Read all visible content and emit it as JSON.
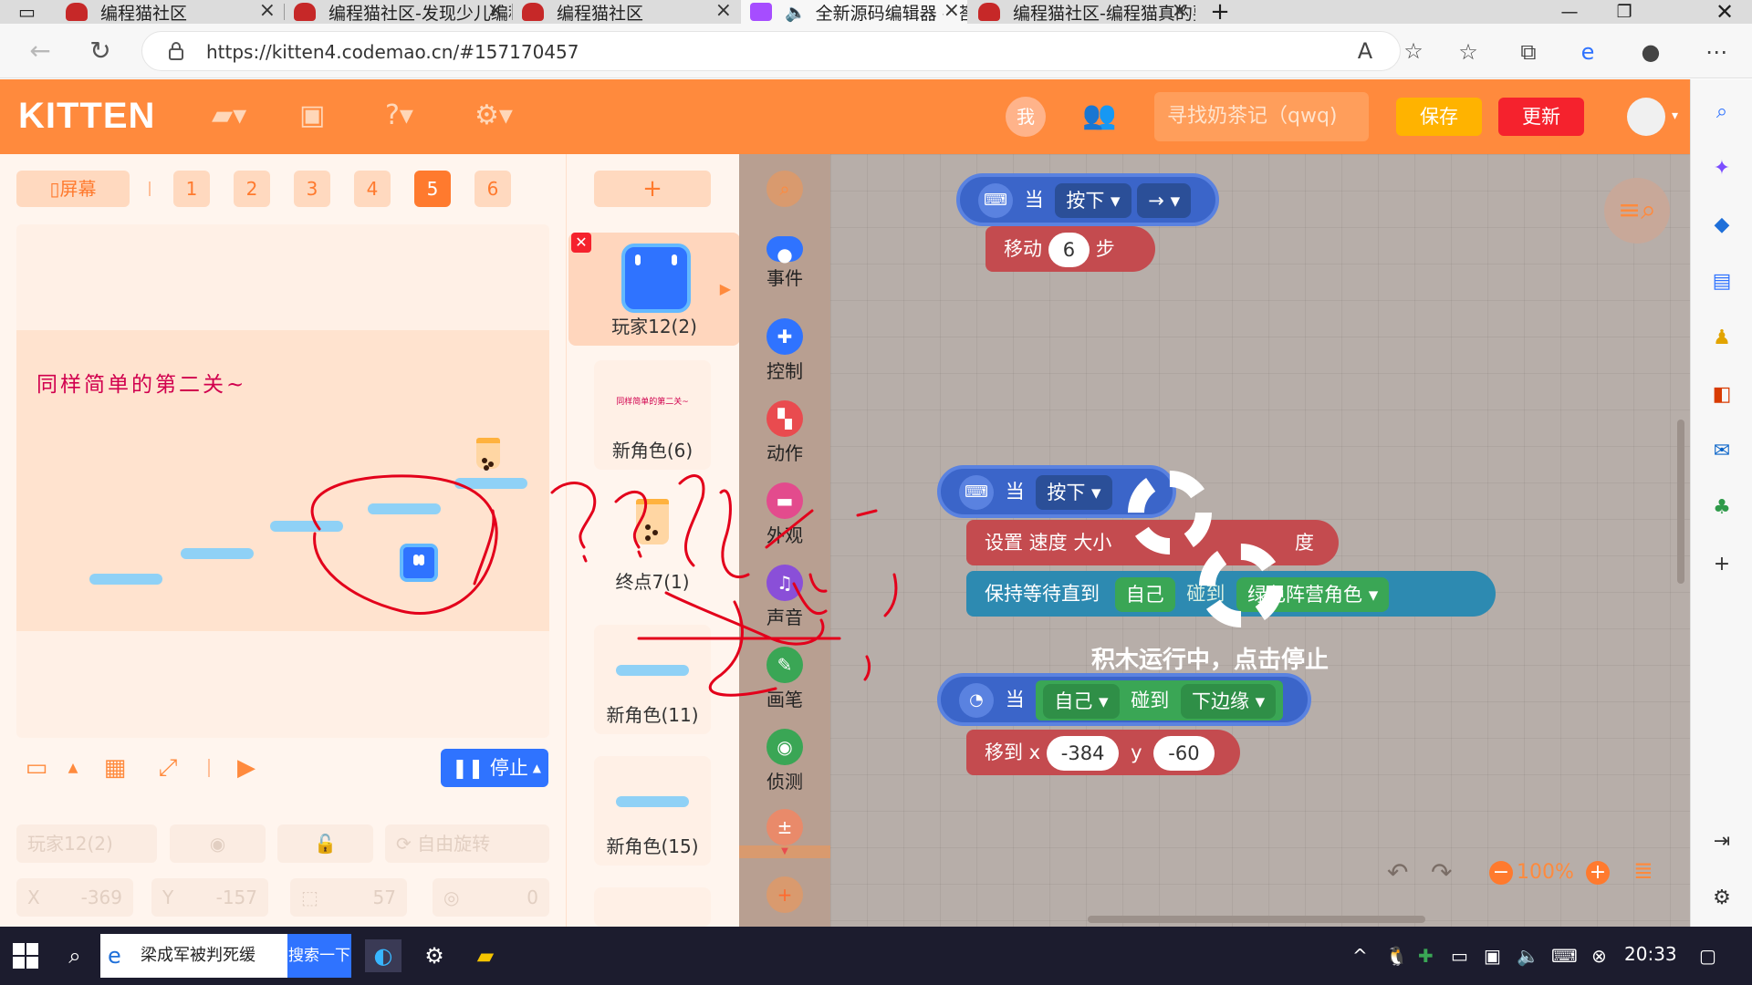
{
  "browser": {
    "tabs": [
      {
        "title": "编程猫社区"
      },
      {
        "title": "编程猫社区-发现少儿编程"
      },
      {
        "title": "编程猫社区"
      },
      {
        "title": "全新源码编辑器 - 搭建"
      },
      {
        "title": "编程猫社区-编程猫真的要"
      }
    ],
    "url": "https://kitten4.codemao.cn/#157170457"
  },
  "header": {
    "logo": "KITTEN",
    "me_label": "我",
    "project_name": "寻找奶茶记（qwq)",
    "save_label": "保存",
    "update_label": "更新"
  },
  "stage_panel": {
    "screen_label": "屏幕",
    "scenes": [
      "1",
      "2",
      "3",
      "4",
      "5",
      "6"
    ],
    "active_scene": "5",
    "stage_text": "同样简单的第二关~",
    "stop_label": "停止",
    "properties": {
      "sprite_name_placeholder": "玩家12(2)",
      "rotate_label": "自由旋转",
      "x_label": "X",
      "x_value": "-369",
      "y_label": "Y",
      "y_value": "-157",
      "size_value": "57",
      "direction_value": "0"
    }
  },
  "sprites": {
    "add_label": "+",
    "items": [
      {
        "name": "玩家12(2)",
        "active": true
      },
      {
        "name": "新角色(6)",
        "thumb_text": "同样简单的第二关~"
      },
      {
        "name": "终点7(1)"
      },
      {
        "name": "新角色(11)"
      },
      {
        "name": "新角色(15)"
      }
    ]
  },
  "categories": [
    {
      "label": "事件",
      "color": "#2f73ff"
    },
    {
      "label": "控制",
      "color": "#2f73ff"
    },
    {
      "label": "动作",
      "color": "#e94b4f"
    },
    {
      "label": "外观",
      "color": "#e34b8d"
    },
    {
      "label": "声音",
      "color": "#8a4fd8"
    },
    {
      "label": "画笔",
      "color": "#3aa655"
    },
    {
      "label": "侦测",
      "color": "#3aa655"
    }
  ],
  "code": {
    "block1": {
      "when": "当",
      "key_action": "按下",
      "key": "→",
      "move_label": "移动",
      "move_value": "6",
      "move_unit": "步"
    },
    "block2": {
      "when": "当",
      "key_action": "按下",
      "set_speed_label": "设置 速度 大小",
      "degree_label": "度",
      "wait_label": "保持等待直到",
      "self_label": "自己",
      "touch_label": "碰到",
      "target_label": "绿色阵营角色"
    },
    "block3": {
      "when": "当",
      "self_label": "自己",
      "touch_label": "碰到",
      "edge_label": "下边缘",
      "moveto_label": "移到 x",
      "x_value": "-384",
      "y_label": "y",
      "y_value": "-60"
    },
    "running_message": "积木运行中，点击停止",
    "zoom": "100%"
  },
  "taskbar": {
    "search_text": "梁成军被判死缓",
    "search_button": "搜索一下",
    "time": "20:33"
  }
}
